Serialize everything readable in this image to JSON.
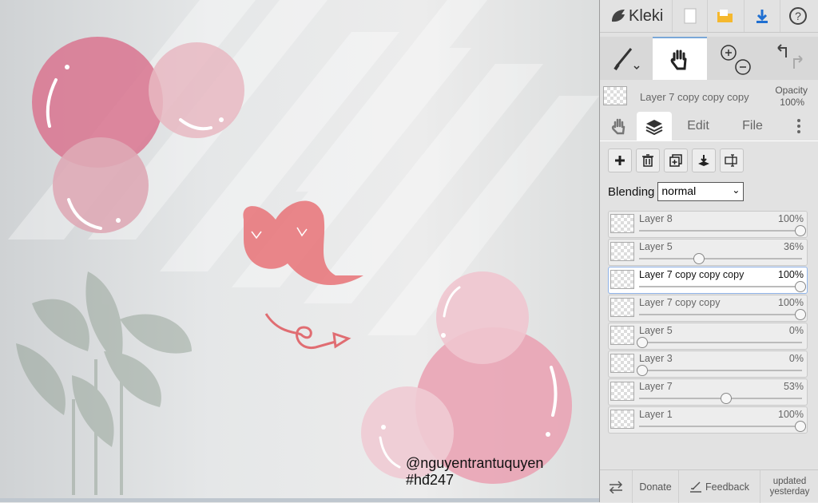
{
  "app": {
    "name": "Kleki"
  },
  "canvas": {
    "watermark_line1": "@nguyentrantuquyen",
    "watermark_line2": "#hđ247"
  },
  "toolbar": {
    "icons": [
      "new-image-icon",
      "open-folder-icon",
      "download-icon",
      "help-icon"
    ],
    "tools": [
      "brush-icon",
      "hand-icon",
      "zoom-in-icon",
      "zoom-out-icon",
      "undo-icon",
      "redo-icon"
    ]
  },
  "current_layer": {
    "name": "Layer 7 copy copy copy",
    "opacity_label": "Opacity",
    "opacity_value": "100%"
  },
  "tabs": [
    {
      "label": "",
      "icon": "hand-icon"
    },
    {
      "label": "",
      "icon": "layers-icon"
    },
    {
      "label": "Edit"
    },
    {
      "label": "File"
    },
    {
      "label": "",
      "icon": "more-icon"
    }
  ],
  "blending": {
    "label": "Blending",
    "value": "normal"
  },
  "layers": [
    {
      "name": "Layer 8",
      "opacity": "100%",
      "value": 1.0,
      "active": false
    },
    {
      "name": "Layer 5",
      "opacity": "36%",
      "value": 0.36,
      "active": false
    },
    {
      "name": "Layer 7 copy copy copy",
      "opacity": "100%",
      "value": 1.0,
      "active": true
    },
    {
      "name": "Layer 7 copy copy",
      "opacity": "100%",
      "value": 1.0,
      "active": false
    },
    {
      "name": "Layer 5",
      "opacity": "0%",
      "value": 0.0,
      "active": false
    },
    {
      "name": "Layer 3",
      "opacity": "0%",
      "value": 0.0,
      "active": false
    },
    {
      "name": "Layer 7",
      "opacity": "53%",
      "value": 0.53,
      "active": false
    },
    {
      "name": "Layer 1",
      "opacity": "100%",
      "value": 1.0,
      "active": false
    }
  ],
  "footer": {
    "donate": "Donate",
    "feedback": "Feedback",
    "updated": "updated yesterday"
  },
  "colors": {
    "accent": "#1f6fd1",
    "bubble": "#e98fa6",
    "panel": "#e2e2e2"
  }
}
